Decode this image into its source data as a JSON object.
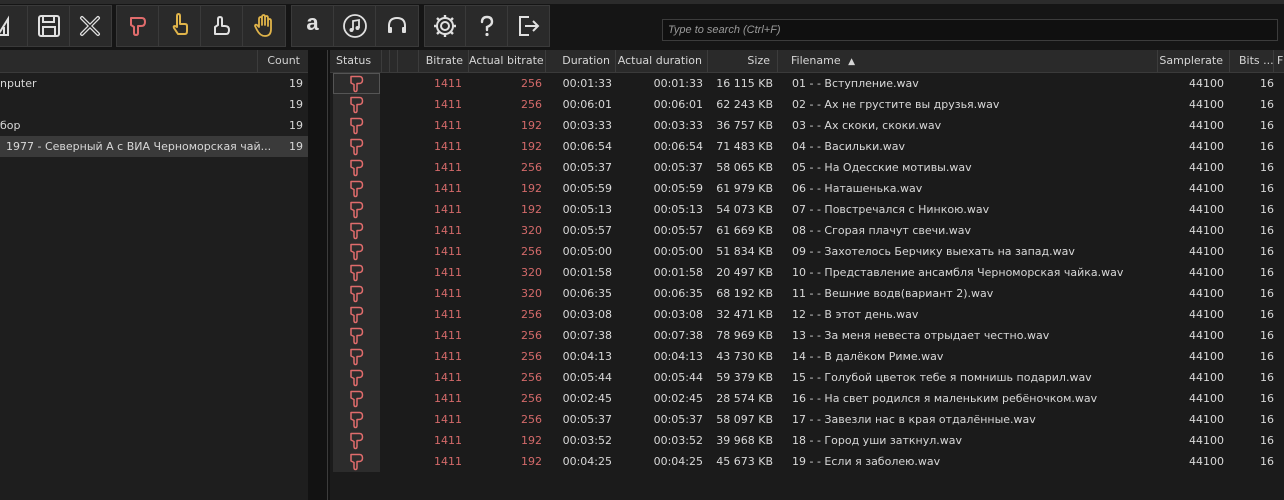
{
  "toolbar": {
    "search_placeholder": "Type to search (Ctrl+F)",
    "amazon_glyph": "a",
    "colors": {
      "rating_bad": "#e06c6c",
      "rating_ok": "#e0b44a",
      "icon_white": "#e0e0e0"
    }
  },
  "left": {
    "header_count": "Count",
    "items": [
      {
        "label": "nputer",
        "count": "19"
      },
      {
        "label": "",
        "count": "19"
      },
      {
        "label": "бор",
        "count": "19"
      },
      {
        "label": "1977 - Северный А с ВИА Черноморская чай...",
        "count": "19"
      }
    ]
  },
  "grid": {
    "headers": {
      "status": "Status",
      "bitrate": "Bitrate",
      "actual_bitrate": "Actual bitrate",
      "duration": "Duration",
      "actual_duration": "Actual duration",
      "size": "Size",
      "filename": "Filename",
      "samplerate": "Samplerate",
      "bits": "Bits ...",
      "extra": "F"
    },
    "rows": [
      {
        "bitrate": "1411",
        "actual": "256",
        "dur": "00:01:33",
        "adur": "00:01:33",
        "size": "16 115 KB",
        "file": "01  -  -  Вступление.wav",
        "sr": "44100",
        "bits": "16"
      },
      {
        "bitrate": "1411",
        "actual": "256",
        "dur": "00:06:01",
        "adur": "00:06:01",
        "size": "62 243 KB",
        "file": "02  -  -  Ах не грустите вы друзья.wav",
        "sr": "44100",
        "bits": "16"
      },
      {
        "bitrate": "1411",
        "actual": "192",
        "dur": "00:03:33",
        "adur": "00:03:33",
        "size": "36 757 KB",
        "file": "03  -  -  Ах скоки, скоки.wav",
        "sr": "44100",
        "bits": "16"
      },
      {
        "bitrate": "1411",
        "actual": "192",
        "dur": "00:06:54",
        "adur": "00:06:54",
        "size": "71 483 KB",
        "file": "04  -  -  Васильки.wav",
        "sr": "44100",
        "bits": "16"
      },
      {
        "bitrate": "1411",
        "actual": "256",
        "dur": "00:05:37",
        "adur": "00:05:37",
        "size": "58 065 KB",
        "file": "05  -  -  На Одесские мотивы.wav",
        "sr": "44100",
        "bits": "16"
      },
      {
        "bitrate": "1411",
        "actual": "192",
        "dur": "00:05:59",
        "adur": "00:05:59",
        "size": "61 979 KB",
        "file": "06  -  -  Наташенька.wav",
        "sr": "44100",
        "bits": "16"
      },
      {
        "bitrate": "1411",
        "actual": "192",
        "dur": "00:05:13",
        "adur": "00:05:13",
        "size": "54 073 KB",
        "file": "07  -  -  Повстречался с Нинкою.wav",
        "sr": "44100",
        "bits": "16"
      },
      {
        "bitrate": "1411",
        "actual": "320",
        "dur": "00:05:57",
        "adur": "00:05:57",
        "size": "61 669 KB",
        "file": "08  -  -  Сгорая плачут свечи.wav",
        "sr": "44100",
        "bits": "16"
      },
      {
        "bitrate": "1411",
        "actual": "256",
        "dur": "00:05:00",
        "adur": "00:05:00",
        "size": "51 834 KB",
        "file": "09  -  -  Захотелось Берчику выехать на запад.wav",
        "sr": "44100",
        "bits": "16"
      },
      {
        "bitrate": "1411",
        "actual": "320",
        "dur": "00:01:58",
        "adur": "00:01:58",
        "size": "20 497 KB",
        "file": "10  -  -  Представление ансамбля Черноморская чайка.wav",
        "sr": "44100",
        "bits": "16"
      },
      {
        "bitrate": "1411",
        "actual": "320",
        "dur": "00:06:35",
        "adur": "00:06:35",
        "size": "68 192 KB",
        "file": "11  -  -  Вешние водв(вариант 2).wav",
        "sr": "44100",
        "bits": "16"
      },
      {
        "bitrate": "1411",
        "actual": "256",
        "dur": "00:03:08",
        "adur": "00:03:08",
        "size": "32 471 KB",
        "file": "12  -  -  В этот день.wav",
        "sr": "44100",
        "bits": "16"
      },
      {
        "bitrate": "1411",
        "actual": "256",
        "dur": "00:07:38",
        "adur": "00:07:38",
        "size": "78 969 KB",
        "file": "13  -  -  За меня невеста отрыдает честно.wav",
        "sr": "44100",
        "bits": "16"
      },
      {
        "bitrate": "1411",
        "actual": "256",
        "dur": "00:04:13",
        "adur": "00:04:13",
        "size": "43 730 KB",
        "file": "14  -  -  В далёком Риме.wav",
        "sr": "44100",
        "bits": "16"
      },
      {
        "bitrate": "1411",
        "actual": "256",
        "dur": "00:05:44",
        "adur": "00:05:44",
        "size": "59 379 KB",
        "file": "15  -  -  Голубой цветок тебе я помнишь подарил.wav",
        "sr": "44100",
        "bits": "16"
      },
      {
        "bitrate": "1411",
        "actual": "256",
        "dur": "00:02:45",
        "adur": "00:02:45",
        "size": "28 574 KB",
        "file": "16  -  -  На свет родился я маленьким ребёночком.wav",
        "sr": "44100",
        "bits": "16"
      },
      {
        "bitrate": "1411",
        "actual": "256",
        "dur": "00:05:37",
        "adur": "00:05:37",
        "size": "58 097 KB",
        "file": "17  -  -  Завезли нас в края отдалённые.wav",
        "sr": "44100",
        "bits": "16"
      },
      {
        "bitrate": "1411",
        "actual": "192",
        "dur": "00:03:52",
        "adur": "00:03:52",
        "size": "39 968 KB",
        "file": "18  -  -  Город уши заткнул.wav",
        "sr": "44100",
        "bits": "16"
      },
      {
        "bitrate": "1411",
        "actual": "192",
        "dur": "00:04:25",
        "adur": "00:04:25",
        "size": "45 673 KB",
        "file": "19  -  -  Если я заболею.wav",
        "sr": "44100",
        "bits": "16"
      }
    ]
  }
}
